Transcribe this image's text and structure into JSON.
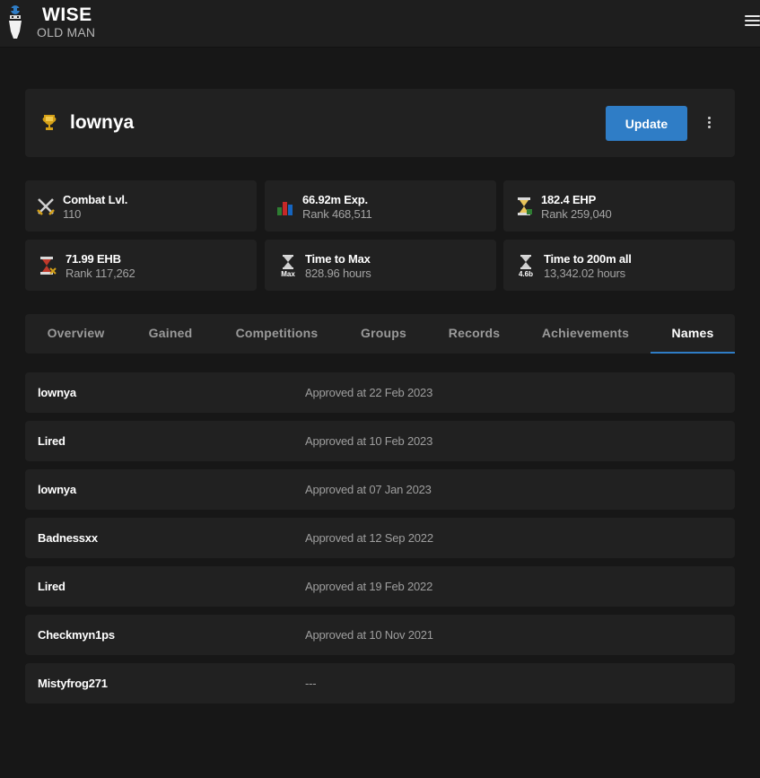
{
  "brand": {
    "title": "WISE",
    "subtitle": "OLD MAN"
  },
  "player": {
    "name": "lownya",
    "update_label": "Update"
  },
  "stats": [
    {
      "icon": "crossed-swords-icon",
      "title": "Combat Lvl.",
      "sub": "110"
    },
    {
      "icon": "bar-chart-icon",
      "title": "66.92m Exp.",
      "sub": "Rank 468,511"
    },
    {
      "icon": "hourglass-ehp-icon",
      "title": "182.4 EHP",
      "sub": "Rank 259,040"
    },
    {
      "icon": "hourglass-ehb-icon",
      "title": "71.99 EHB",
      "sub": "Rank 117,262"
    },
    {
      "icon": "hourglass-max-icon",
      "badge": "Max",
      "title": "Time to Max",
      "sub": "828.96 hours"
    },
    {
      "icon": "hourglass-200m-icon",
      "badge": "4.6b",
      "title": "Time to 200m all",
      "sub": "13,342.02 hours"
    }
  ],
  "tabs": [
    "Overview",
    "Gained",
    "Competitions",
    "Groups",
    "Records",
    "Achievements",
    "Names"
  ],
  "active_tab": "Names",
  "names": [
    {
      "name": "lownya",
      "status": "Approved at 22 Feb 2023"
    },
    {
      "name": "Lired",
      "status": "Approved at 10 Feb 2023"
    },
    {
      "name": "lownya",
      "status": "Approved at 07 Jan 2023"
    },
    {
      "name": "Badnessxx",
      "status": "Approved at 12 Sep 2022"
    },
    {
      "name": "Lired",
      "status": "Approved at 19 Feb 2022"
    },
    {
      "name": "Checkmyn1ps",
      "status": "Approved at 10 Nov 2021"
    },
    {
      "name": "Mistyfrog271",
      "status": "---"
    }
  ],
  "colors": {
    "accent": "#2f7dc6",
    "card": "#212121",
    "background": "#171717"
  }
}
